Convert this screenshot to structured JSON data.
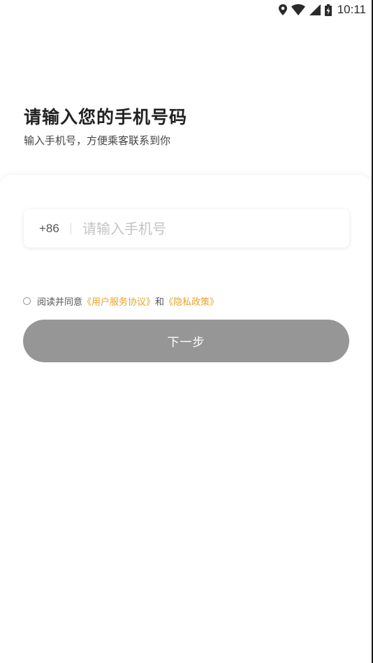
{
  "status_bar": {
    "time": "10:11",
    "icons": [
      "location-icon",
      "wifi-icon",
      "signal-icon",
      "battery-charging-icon"
    ]
  },
  "header": {
    "title": "请输入您的手机号码",
    "subtitle": "输入手机号，方便乘客联系到你"
  },
  "phone": {
    "country_code": "+86",
    "placeholder": "请输入手机号",
    "value": ""
  },
  "agreement": {
    "prefix": "阅读并同意",
    "user_agreement": "《用户服务协议》",
    "conjunction": "和",
    "privacy_policy": "《隐私政策》",
    "checked": false
  },
  "next_button": {
    "label": "下一步"
  },
  "colors": {
    "link": "#e9a22a",
    "button_bg": "#969696",
    "title": "#222222",
    "placeholder": "#c4c4c4"
  }
}
